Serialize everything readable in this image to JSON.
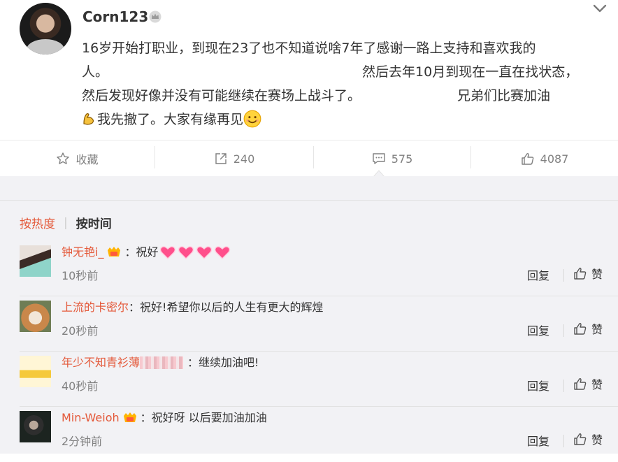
{
  "post": {
    "username": "Corn123",
    "text_line1": "16岁开始打职业，到现在23了也不知道说啥7年了感谢一路上支持和喜欢我的",
    "text_line2_a": "人。",
    "text_line2_b": "然后去年10月到现在一直在找状态，",
    "text_line3_a": "然后发现好像并没有可能继续在赛场上战斗了。",
    "text_line3_b": "兄弟们比赛加油",
    "text_line4": "我先撤了。大家有缘再见"
  },
  "actions": {
    "favorite_label": "收藏",
    "share_count": "240",
    "comment_count": "575",
    "like_count": "4087"
  },
  "sort": {
    "hot_label": "按热度",
    "time_label": "按时间"
  },
  "comments": [
    {
      "user": "钟无艳i_",
      "colon": "：",
      "text": "祝好",
      "time": "10秒前",
      "reply": "回复",
      "like": "赞"
    },
    {
      "user": "上流的卡密尔",
      "colon": "：",
      "text": "祝好!希望你以后的人生有更大的辉煌",
      "time": "20秒前",
      "reply": "回复",
      "like": "赞"
    },
    {
      "user": "年少不知青衫薄",
      "colon": "：",
      "text": "继续加油吧!",
      "time": "40秒前",
      "reply": "回复",
      "like": "赞"
    },
    {
      "user": "Min-Weioh",
      "colon": "：",
      "text": "祝好呀 以后要加油加油",
      "time": "2分钟前",
      "reply": "回复",
      "like": "赞"
    }
  ],
  "colors": {
    "accent": "#e4593a",
    "muted": "#808080",
    "comment_bg": "#f2f2f5"
  },
  "icons": [
    "crown-icon",
    "chevron-down-icon",
    "star-icon",
    "share-icon",
    "comment-icon",
    "thumbs-up-icon",
    "flex-arm-emoji-icon",
    "smile-emoji-icon",
    "heart-emoji-icon",
    "vip-badge-icon"
  ]
}
